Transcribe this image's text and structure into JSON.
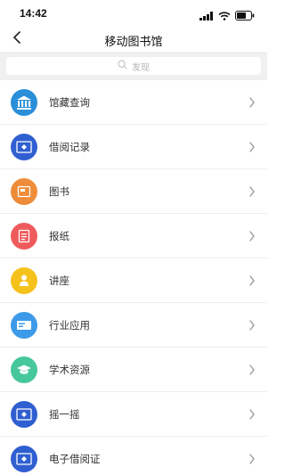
{
  "status": {
    "time": "14:42"
  },
  "header": {
    "title": "移动图书馆"
  },
  "search": {
    "placeholder": "发现"
  },
  "menu": [
    {
      "label": "馆藏查询",
      "icon": "library-icon",
      "color": "#2a8ed9"
    },
    {
      "label": "借阅记录",
      "icon": "screen-icon",
      "color": "#2f5fd0"
    },
    {
      "label": "图书",
      "icon": "book-icon",
      "color": "#ef8c3a"
    },
    {
      "label": "报纸",
      "icon": "newspaper-icon",
      "color": "#ef5b5b"
    },
    {
      "label": "讲座",
      "icon": "speaker-icon",
      "color": "#f5c21b"
    },
    {
      "label": "行业应用",
      "icon": "card-icon",
      "color": "#3d9ae8"
    },
    {
      "label": "学术资源",
      "icon": "graduation-cap-icon",
      "color": "#46c79c"
    },
    {
      "label": "摇一摇",
      "icon": "screen-icon",
      "color": "#2f5fd0"
    },
    {
      "label": "电子借阅证",
      "icon": "screen-icon",
      "color": "#2f5fd0"
    }
  ]
}
